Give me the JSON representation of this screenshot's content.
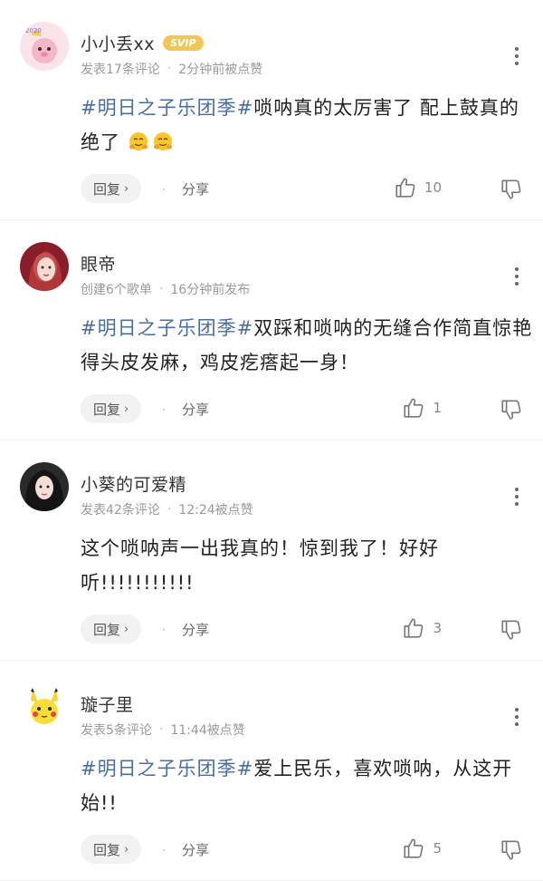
{
  "comments": [
    {
      "name": "小小丢xx",
      "badge": "SVIP",
      "stat": "发表17条评论",
      "time": "2分钟前被点赞",
      "tag": "#明日之子乐团季#",
      "text": "唢呐真的太厉害了 配上鼓真的绝了",
      "emoji": [
        "hug-emoji",
        "hug-emoji"
      ],
      "likes": "10",
      "reply_label": "回复",
      "share_label": "分享"
    },
    {
      "name": "眼帝",
      "badge": "",
      "stat": "创建6个歌单",
      "time": "16分钟前发布",
      "tag": "#明日之子乐团季#",
      "text": "双踩和唢呐的无缝合作简直惊艳得头皮发麻，鸡皮疙瘩起一身！",
      "emoji": [],
      "likes": "1",
      "reply_label": "回复",
      "share_label": "分享"
    },
    {
      "name": "小葵的可爱精",
      "badge": "",
      "stat": "发表42条评论",
      "time": "12:24被点赞",
      "tag": "",
      "text": "这个唢呐声一出我真的！惊到我了！好好听!!!!!!!!!!!",
      "emoji": [],
      "likes": "3",
      "reply_label": "回复",
      "share_label": "分享"
    },
    {
      "name": "璇子里",
      "badge": "",
      "stat": "发表5条评论",
      "time": "11:44被点赞",
      "tag": "#明日之子乐团季#",
      "text": "爱上民乐，喜欢唢呐，从这开始!!",
      "emoji": [],
      "likes": "5",
      "reply_label": "回复",
      "share_label": "分享"
    }
  ],
  "colors": {
    "tag": "#4a6f9e",
    "vip": "#f1c659",
    "meta": "#9a9a9a"
  }
}
